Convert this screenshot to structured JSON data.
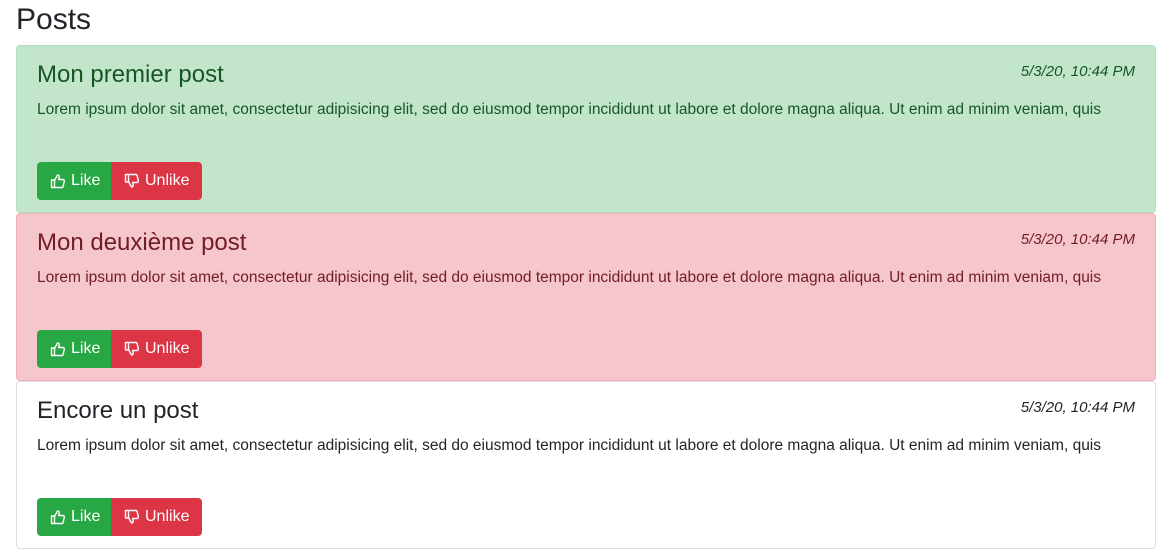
{
  "page": {
    "title": "Posts"
  },
  "posts": [
    {
      "title": "Mon premier post",
      "date": "5/3/20, 10:44 PM",
      "content": "Lorem ipsum dolor sit amet, consectetur adipisicing elit, sed do eiusmod tempor incididunt ut labore et dolore magna aliqua. Ut enim ad minim veniam, quis",
      "state": "liked",
      "like_label": "Like",
      "unlike_label": "Unlike"
    },
    {
      "title": "Mon deuxième post",
      "date": "5/3/20, 10:44 PM",
      "content": "Lorem ipsum dolor sit amet, consectetur adipisicing elit, sed do eiusmod tempor incididunt ut labore et dolore magna aliqua. Ut enim ad minim veniam, quis",
      "state": "unliked",
      "like_label": "Like",
      "unlike_label": "Unlike"
    },
    {
      "title": "Encore un post",
      "date": "5/3/20, 10:44 PM",
      "content": "Lorem ipsum dolor sit amet, consectetur adipisicing elit, sed do eiusmod tempor incididunt ut labore et dolore magna aliqua. Ut enim ad minim veniam, quis",
      "state": "neutral",
      "like_label": "Like",
      "unlike_label": "Unlike"
    }
  ],
  "icons": {
    "like": "thumbs-up-icon",
    "unlike": "thumbs-down-icon"
  },
  "colors": {
    "liked_bg": "#c3e6cb",
    "unliked_bg": "#f5c6cb",
    "like_button": "#28a745",
    "unlike_button": "#dc3545"
  }
}
